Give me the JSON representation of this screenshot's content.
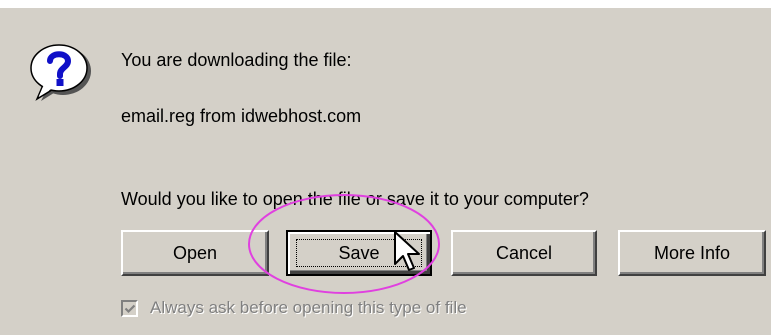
{
  "dialog": {
    "line1": "You are downloading the file:",
    "line2": "email.reg from idwebhost.com",
    "question": "Would you like to open the file or save it to your computer?",
    "icon": "question-icon"
  },
  "buttons": {
    "open": "Open",
    "save": "Save",
    "cancel": "Cancel",
    "more_info": "More Info"
  },
  "checkbox": {
    "label": "Always ask before opening this type of file",
    "checked": true,
    "disabled": true
  },
  "annotation": {
    "highlight_color": "#e040e0",
    "target": "save-button"
  },
  "colors": {
    "dialog_bg": "#d4d0c8",
    "icon_blue": "#1010c8"
  }
}
